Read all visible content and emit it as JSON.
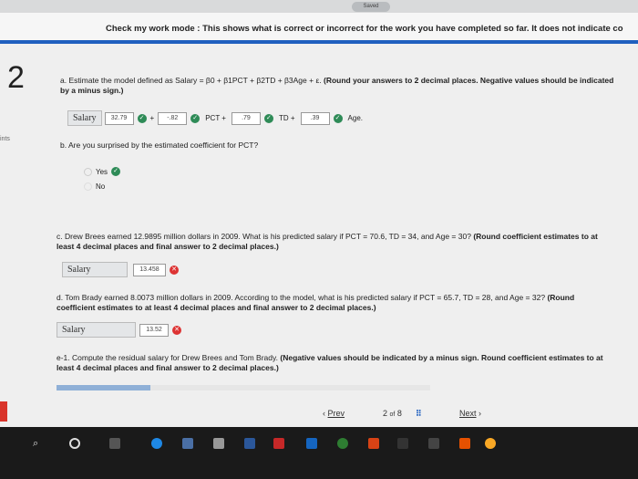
{
  "top": {
    "saved_label": "Saved"
  },
  "banner": {
    "text": "Check my work mode : This shows what is correct or incorrect for the work you have completed so far. It does not indicate co"
  },
  "question_number": "2",
  "side_label": "ints",
  "part_a": {
    "prompt": "a. Estimate the model defined as Salary = β0 + β1PCT + β2TD + β3Age + ε.",
    "instruction": "(Round your answers to 2 decimal places. Negative values should be indicated by a minus sign.)",
    "salary_label": "Salary",
    "b0": "32.79",
    "b1": "-.82",
    "b1_term": "PCT +",
    "b2": ".79",
    "b2_term": "TD +",
    "b3": ".39",
    "b3_term": "Age."
  },
  "part_b": {
    "prompt": "b. Are you surprised by the estimated coefficient for PCT?",
    "options": [
      "Yes",
      "No"
    ]
  },
  "part_c": {
    "prompt": "c. Drew Brees earned 12.9895 million dollars in 2009. What is his predicted salary if PCT = 70.6, TD = 34, and Age = 30?",
    "instruction": "(Round coefficient estimates to at least 4 decimal places and final answer to 2 decimal places.)",
    "salary_label": "Salary",
    "value": "13.458"
  },
  "part_d": {
    "prompt": "d. Tom Brady earned 8.0073 million dollars in 2009. According to the model, what is his predicted salary if PCT = 65.7, TD = 28, and Age = 32?",
    "instruction": "(Round coefficient estimates to at least 4 decimal places and final answer to 2 decimal places.)",
    "salary_label": "Salary",
    "value": "13.52"
  },
  "part_e1": {
    "prompt": "e-1. Compute the residual salary for Drew Brees and Tom Brady.",
    "instruction": "(Negative values should be indicated by a minus sign. Round coefficient estimates to at least 4 decimal places and final answer to 2 decimal places.)"
  },
  "nav": {
    "prev": "Prev",
    "page_current": "2",
    "page_of": "of",
    "page_total": "8",
    "next": "Next"
  },
  "colors": {
    "accent": "#1f5fbf",
    "correct": "#2e8b57",
    "incorrect": "#d33333"
  }
}
